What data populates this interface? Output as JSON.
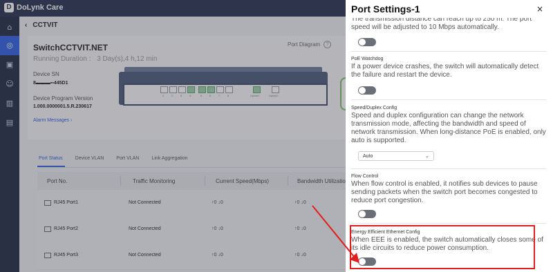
{
  "app": {
    "name": "DoLynk Care",
    "logo_letter": "D"
  },
  "rail_icons": [
    "home-icon",
    "location-icon",
    "device-icon",
    "users-icon",
    "building-icon",
    "inbox-icon"
  ],
  "breadcrumb": {
    "back": "‹",
    "title": "CCTVIT"
  },
  "device": {
    "name": "SwitchCCTVIT.NET",
    "running_label": "Running Duration :",
    "running_value": "3 Day(s),4 h,12 min",
    "sn_label": "Device SN",
    "sn_value": "8▬▬▬▪▪445D1",
    "program_label": "Device Program Version",
    "program_value": "1.000.0000001.5.R.230617",
    "alarm_link": "Alarm Messages ›",
    "port_diagram": "Port Diagram",
    "port_numbers": [
      "1",
      "2",
      "3",
      "4",
      "5",
      "6",
      "7",
      "8"
    ],
    "uplinks": [
      "Uplink1",
      "Uplink2"
    ]
  },
  "tabs": [
    "Port Status",
    "Device VLAN",
    "Port VLAN",
    "Link Aggregation"
  ],
  "table": {
    "headers": [
      "Port No.",
      "Traffic Monitoring",
      "Current Speed(Mbps)",
      "Bandwidth Utilizatio"
    ],
    "rows": [
      {
        "port": "RJ45 Port1",
        "traffic": "Not Connected",
        "speed": "↑0  ↓0",
        "bw": "↑0  ↓0"
      },
      {
        "port": "RJ45 Port2",
        "traffic": "Not Connected",
        "speed": "↑0  ↓0",
        "bw": "↑0  ↓0"
      },
      {
        "port": "RJ45 Port3",
        "traffic": "Not Connected",
        "speed": "↑0  ↓0",
        "bw": "↑0  ↓0"
      }
    ]
  },
  "panel": {
    "title": "Port Settings-1",
    "close": "×",
    "top_text": "The transmission distance can reach up to 250 m. The port speed will be adjusted to 10 Mbps automatically.",
    "sections": [
      {
        "title": "PoE Watchdog",
        "desc": "If a power device crashes, the switch will automatically detect the failure and restart the device."
      },
      {
        "title": "Speed/Duplex Config",
        "desc": "Speed and duplex configuration can change the network transmission mode, affecting the bandwidth and speed of network transmission. When long-distance PoE is enabled, only auto is supported.",
        "select": "Auto"
      },
      {
        "title": "Flow Control",
        "desc": "When flow control is enabled, it notifies sub devices to pause sending packets when the switch port becomes congested to reduce port congestion."
      },
      {
        "title": "Energy Efficient Ethernet Config",
        "desc": "When EEE is enabled, the switch automatically closes some of its idle circuits to reduce power consumption."
      }
    ]
  },
  "colors": {
    "accent": "#2f5fe3",
    "highlight": "#e11d1d",
    "toggle_off": "#6b6f76"
  }
}
